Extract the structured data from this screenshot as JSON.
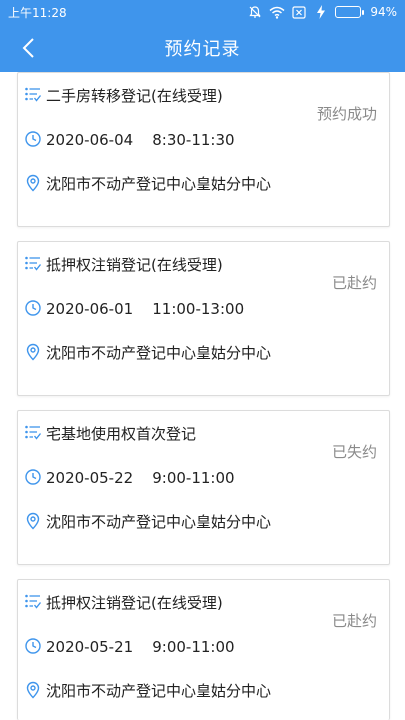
{
  "status_bar": {
    "time": "上午11:28",
    "battery": "94%",
    "battery_level": 0.94
  },
  "header": {
    "title": "预约记录"
  },
  "colors": {
    "accent": "#3f95ec",
    "status_gray": "#8a8a8a"
  },
  "records": [
    {
      "title": "二手房转移登记(在线受理)",
      "datetime": "2020-06-04    8:30-11:30",
      "location": "沈阳市不动产登记中心皇姑分中心",
      "status": "预约成功"
    },
    {
      "title": "抵押权注销登记(在线受理)",
      "datetime": "2020-06-01    11:00-13:00",
      "location": "沈阳市不动产登记中心皇姑分中心",
      "status": "已赴约"
    },
    {
      "title": "宅基地使用权首次登记",
      "datetime": "2020-05-22    9:00-11:00",
      "location": "沈阳市不动产登记中心皇姑分中心",
      "status": "已失约"
    },
    {
      "title": "抵押权注销登记(在线受理)",
      "datetime": "2020-05-21    9:00-11:00",
      "location": "沈阳市不动产登记中心皇姑分中心",
      "status": "已赴约"
    }
  ]
}
